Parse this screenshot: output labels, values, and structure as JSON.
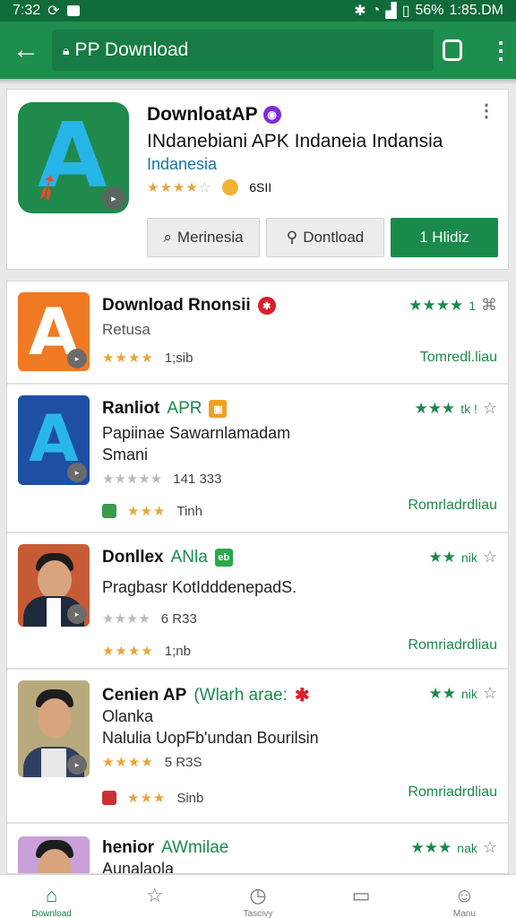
{
  "status": {
    "time": "7:32",
    "battery": "56%",
    "clock_right": "1:85.DM"
  },
  "urlbar": {
    "url": "PP Download",
    "tab_count": ""
  },
  "featured": {
    "title": "DownloatAP",
    "subtitle": "INdanebiani APK Indaneia Indansia",
    "developer": "Indanesia",
    "stars": "★★★★",
    "stars_off": "☆",
    "count": "6SII",
    "buttons": [
      "Merinesia",
      "Dontload",
      "1 Hlidiz"
    ]
  },
  "items": [
    {
      "title": "Download Rnonsii",
      "accent": "",
      "line1": "Retusa",
      "line2": "",
      "meta_stars": "★★★★",
      "meta_count": "1;sib",
      "extra_meta": "",
      "extra_stars": "",
      "extra_count": "",
      "right_stars": "★★★★",
      "right_text": "1",
      "link": "Tomredl.liau"
    },
    {
      "title": "Ranliot",
      "accent": "APR",
      "line1": "Papiinae Sawarnlamadam",
      "line2": "Smani",
      "meta_stars": "★★★★★",
      "meta_count": "141 333",
      "extra_stars": "★★★",
      "extra_count": "Tinh",
      "right_stars": "★★★",
      "right_text": "tk !",
      "link": "Romrladrdliau"
    },
    {
      "title": "Donllex",
      "accent": "ANla",
      "line1": "Pragbasr KotIdddenepadS.",
      "line2": "",
      "meta_stars": "★★★★",
      "meta_count": "6 R33",
      "extra_stars": "★★★★",
      "extra_count": "1;nb",
      "right_stars": "★★",
      "right_text": "nik",
      "link": "Romriadrdliau"
    },
    {
      "title": "Cenien AP",
      "accent": "(Wlarh arae:",
      "line1": "Olanka",
      "line2": "Nalulia UopFb'undan Bourilsin",
      "meta_stars": "★★★★",
      "meta_count": "5 R3S",
      "extra_stars": "★★★",
      "extra_count": "Sinb",
      "right_stars": "★★",
      "right_text": "nik",
      "link": "Romriadrdliau"
    },
    {
      "title": "henior",
      "accent": "AWmilae",
      "line1": "Aunalaola",
      "right_stars": "★★★",
      "right_text": "nak"
    }
  ],
  "nav": [
    {
      "label": "Download",
      "icon": "home-icon"
    },
    {
      "label": "",
      "icon": "star-icon"
    },
    {
      "label": "Tascivy",
      "icon": "clock-icon"
    },
    {
      "label": "",
      "icon": "book-icon"
    },
    {
      "label": "Manu",
      "icon": "person-icon"
    }
  ],
  "colors": {
    "brand": "#1e8e4e",
    "status": "#0f6b3a",
    "accent_green": "#1a8a4a",
    "link_blue": "#1675a8"
  }
}
